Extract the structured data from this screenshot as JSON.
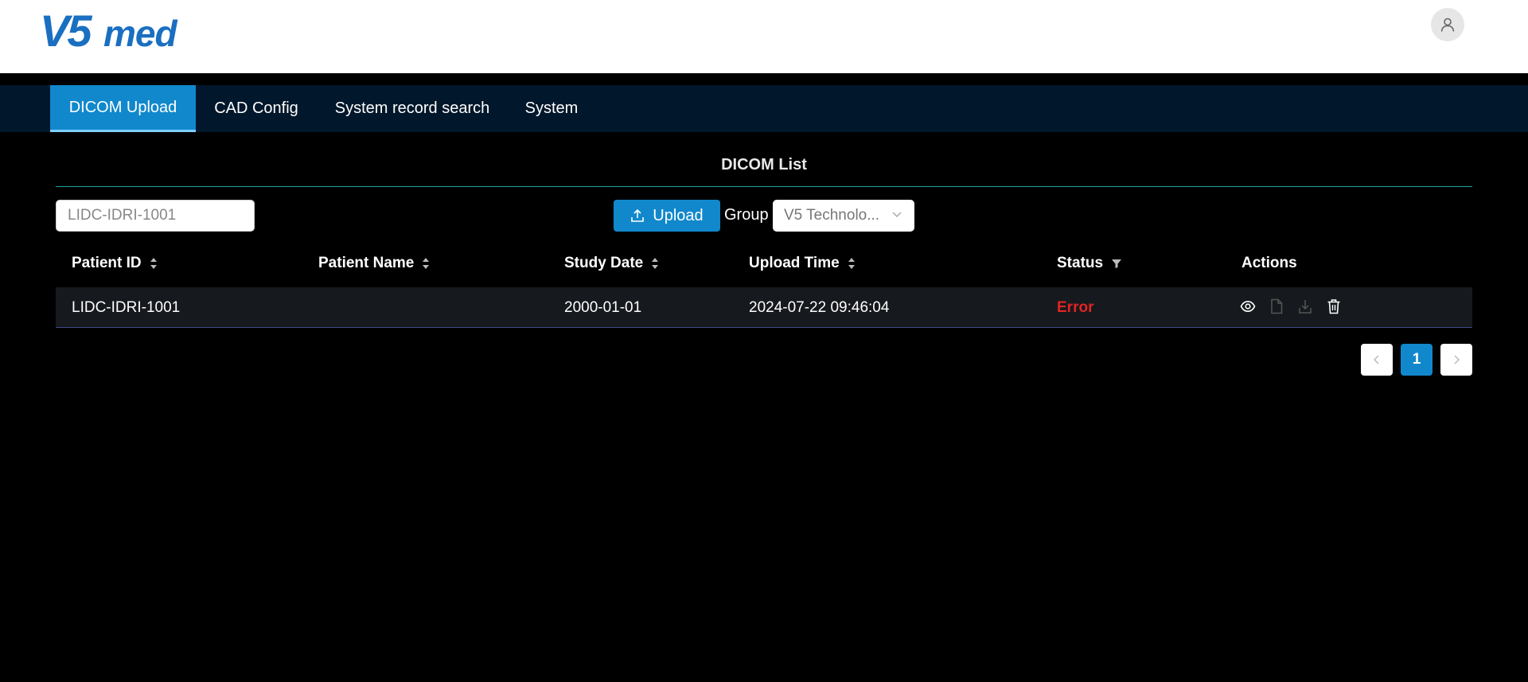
{
  "brand": {
    "logo_text": "V5med",
    "color": "#1a6fc1"
  },
  "header": {
    "avatar_icon": "user-icon"
  },
  "nav": {
    "tabs": [
      {
        "label": "DICOM Upload",
        "active": true
      },
      {
        "label": "CAD Config",
        "active": false
      },
      {
        "label": "System record search",
        "active": false
      },
      {
        "label": "System",
        "active": false
      }
    ]
  },
  "main": {
    "title": "DICOM List",
    "search": {
      "value": "LIDC-IDRI-1001"
    },
    "upload_label": "Upload",
    "group_label": "Group",
    "group_selected": "V5 Technolo..."
  },
  "table": {
    "columns": [
      {
        "label": "Patient ID",
        "control": "sort"
      },
      {
        "label": "Patient Name",
        "control": "sort"
      },
      {
        "label": "Study Date",
        "control": "sort"
      },
      {
        "label": "Upload Time",
        "control": "sort"
      },
      {
        "label": "Status",
        "control": "filter"
      },
      {
        "label": "Actions",
        "control": "none"
      }
    ],
    "rows": [
      {
        "patient_id": "LIDC-IDRI-1001",
        "patient_name": "",
        "study_date": "2000-01-01",
        "upload_time": "2024-07-22 09:46:04",
        "status": "Error",
        "status_color": "#e02424",
        "actions": [
          "eye-icon",
          "file-icon",
          "download-icon",
          "trash-icon"
        ]
      }
    ]
  },
  "pagination": {
    "current_page": "1"
  },
  "colors": {
    "accent": "#1188cc",
    "nav_bg": "#01172b",
    "divider": "#18a5a0"
  }
}
